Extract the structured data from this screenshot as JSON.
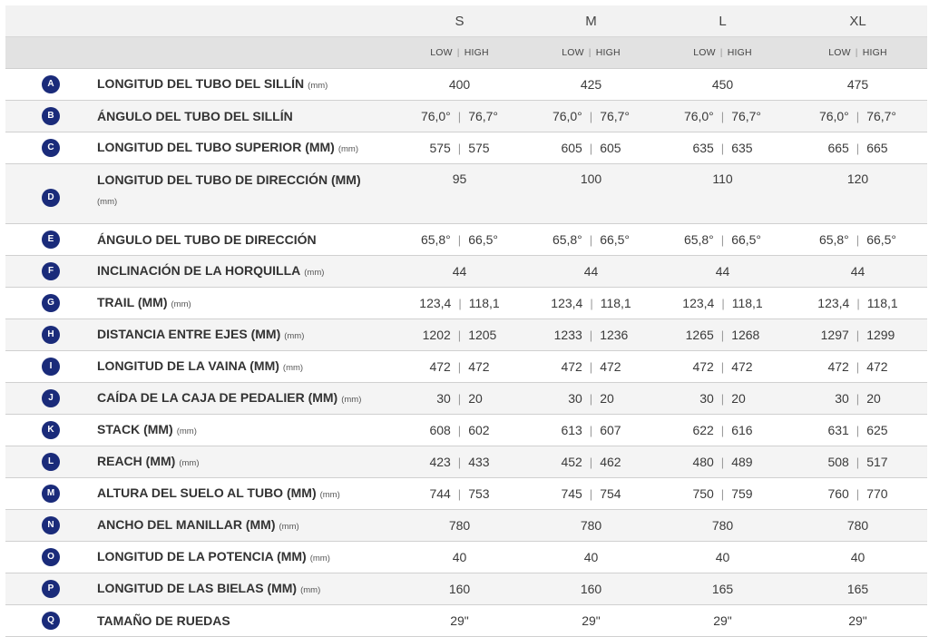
{
  "sizes": [
    "S",
    "M",
    "L",
    "XL"
  ],
  "modes": {
    "low": "LOW",
    "high": "HIGH"
  },
  "rows": [
    {
      "letter": "A",
      "label": "LONGITUD DEL TUBO DEL SILLÍN",
      "unit": "(mm)",
      "values": [
        "400",
        "425",
        "450",
        "475"
      ]
    },
    {
      "letter": "B",
      "label": "ÁNGULO DEL TUBO DEL SILLÍN",
      "unit": "",
      "values": [
        [
          "76,0°",
          "76,7°"
        ],
        [
          "76,0°",
          "76,7°"
        ],
        [
          "76,0°",
          "76,7°"
        ],
        [
          "76,0°",
          "76,7°"
        ]
      ]
    },
    {
      "letter": "C",
      "label": "LONGITUD DEL TUBO SUPERIOR (MM)",
      "unit": "(mm)",
      "values": [
        [
          "575",
          "575"
        ],
        [
          "605",
          "605"
        ],
        [
          "635",
          "635"
        ],
        [
          "665",
          "665"
        ]
      ]
    },
    {
      "letter": "D",
      "label": "LONGITUD DEL TUBO DE DIRECCIÓN (MM)",
      "unit": "(mm)",
      "tall": true,
      "values": [
        "95",
        "100",
        "110",
        "120"
      ]
    },
    {
      "letter": "E",
      "label": "ÁNGULO DEL TUBO DE DIRECCIÓN",
      "unit": "",
      "values": [
        [
          "65,8°",
          "66,5°"
        ],
        [
          "65,8°",
          "66,5°"
        ],
        [
          "65,8°",
          "66,5°"
        ],
        [
          "65,8°",
          "66,5°"
        ]
      ]
    },
    {
      "letter": "F",
      "label": "INCLINACIÓN DE LA HORQUILLA",
      "unit": "(mm)",
      "values": [
        "44",
        "44",
        "44",
        "44"
      ]
    },
    {
      "letter": "G",
      "label": "TRAIL (MM)",
      "unit": "(mm)",
      "values": [
        [
          "123,4",
          "118,1"
        ],
        [
          "123,4",
          "118,1"
        ],
        [
          "123,4",
          "118,1"
        ],
        [
          "123,4",
          "118,1"
        ]
      ]
    },
    {
      "letter": "H",
      "label": "DISTANCIA ENTRE EJES (MM)",
      "unit": "(mm)",
      "values": [
        [
          "1202",
          "1205"
        ],
        [
          "1233",
          "1236"
        ],
        [
          "1265",
          "1268"
        ],
        [
          "1297",
          "1299"
        ]
      ]
    },
    {
      "letter": "I",
      "label": "LONGITUD DE LA VAINA (MM)",
      "unit": "(mm)",
      "values": [
        [
          "472",
          "472"
        ],
        [
          "472",
          "472"
        ],
        [
          "472",
          "472"
        ],
        [
          "472",
          "472"
        ]
      ]
    },
    {
      "letter": "J",
      "label": "CAÍDA DE LA CAJA DE PEDALIER (MM)",
      "unit": "(mm)",
      "values": [
        [
          "30",
          "20"
        ],
        [
          "30",
          "20"
        ],
        [
          "30",
          "20"
        ],
        [
          "30",
          "20"
        ]
      ]
    },
    {
      "letter": "K",
      "label": "STACK (MM)",
      "unit": "(mm)",
      "values": [
        [
          "608",
          "602"
        ],
        [
          "613",
          "607"
        ],
        [
          "622",
          "616"
        ],
        [
          "631",
          "625"
        ]
      ]
    },
    {
      "letter": "L",
      "label": "REACH (MM)",
      "unit": "(mm)",
      "values": [
        [
          "423",
          "433"
        ],
        [
          "452",
          "462"
        ],
        [
          "480",
          "489"
        ],
        [
          "508",
          "517"
        ]
      ]
    },
    {
      "letter": "M",
      "label": "ALTURA DEL SUELO AL TUBO (MM)",
      "unit": "(mm)",
      "values": [
        [
          "744",
          "753"
        ],
        [
          "745",
          "754"
        ],
        [
          "750",
          "759"
        ],
        [
          "760",
          "770"
        ]
      ]
    },
    {
      "letter": "N",
      "label": "ANCHO DEL MANILLAR (MM)",
      "unit": "(mm)",
      "values": [
        "780",
        "780",
        "780",
        "780"
      ]
    },
    {
      "letter": "O",
      "label": "LONGITUD DE LA POTENCIA (MM)",
      "unit": "(mm)",
      "values": [
        "40",
        "40",
        "40",
        "40"
      ]
    },
    {
      "letter": "P",
      "label": "LONGITUD DE LAS BIELAS (MM)",
      "unit": "(mm)",
      "values": [
        "160",
        "160",
        "165",
        "165"
      ]
    },
    {
      "letter": "Q",
      "label": "TAMAÑO DE RUEDAS",
      "unit": "",
      "values": [
        "29\"",
        "29\"",
        "29\"",
        "29\""
      ]
    }
  ],
  "colors": {
    "badge": "#1a2b7a",
    "header_top": "#f2f2f2",
    "header_modes": "#e2e2e2",
    "row_alt": "#f4f4f4"
  }
}
